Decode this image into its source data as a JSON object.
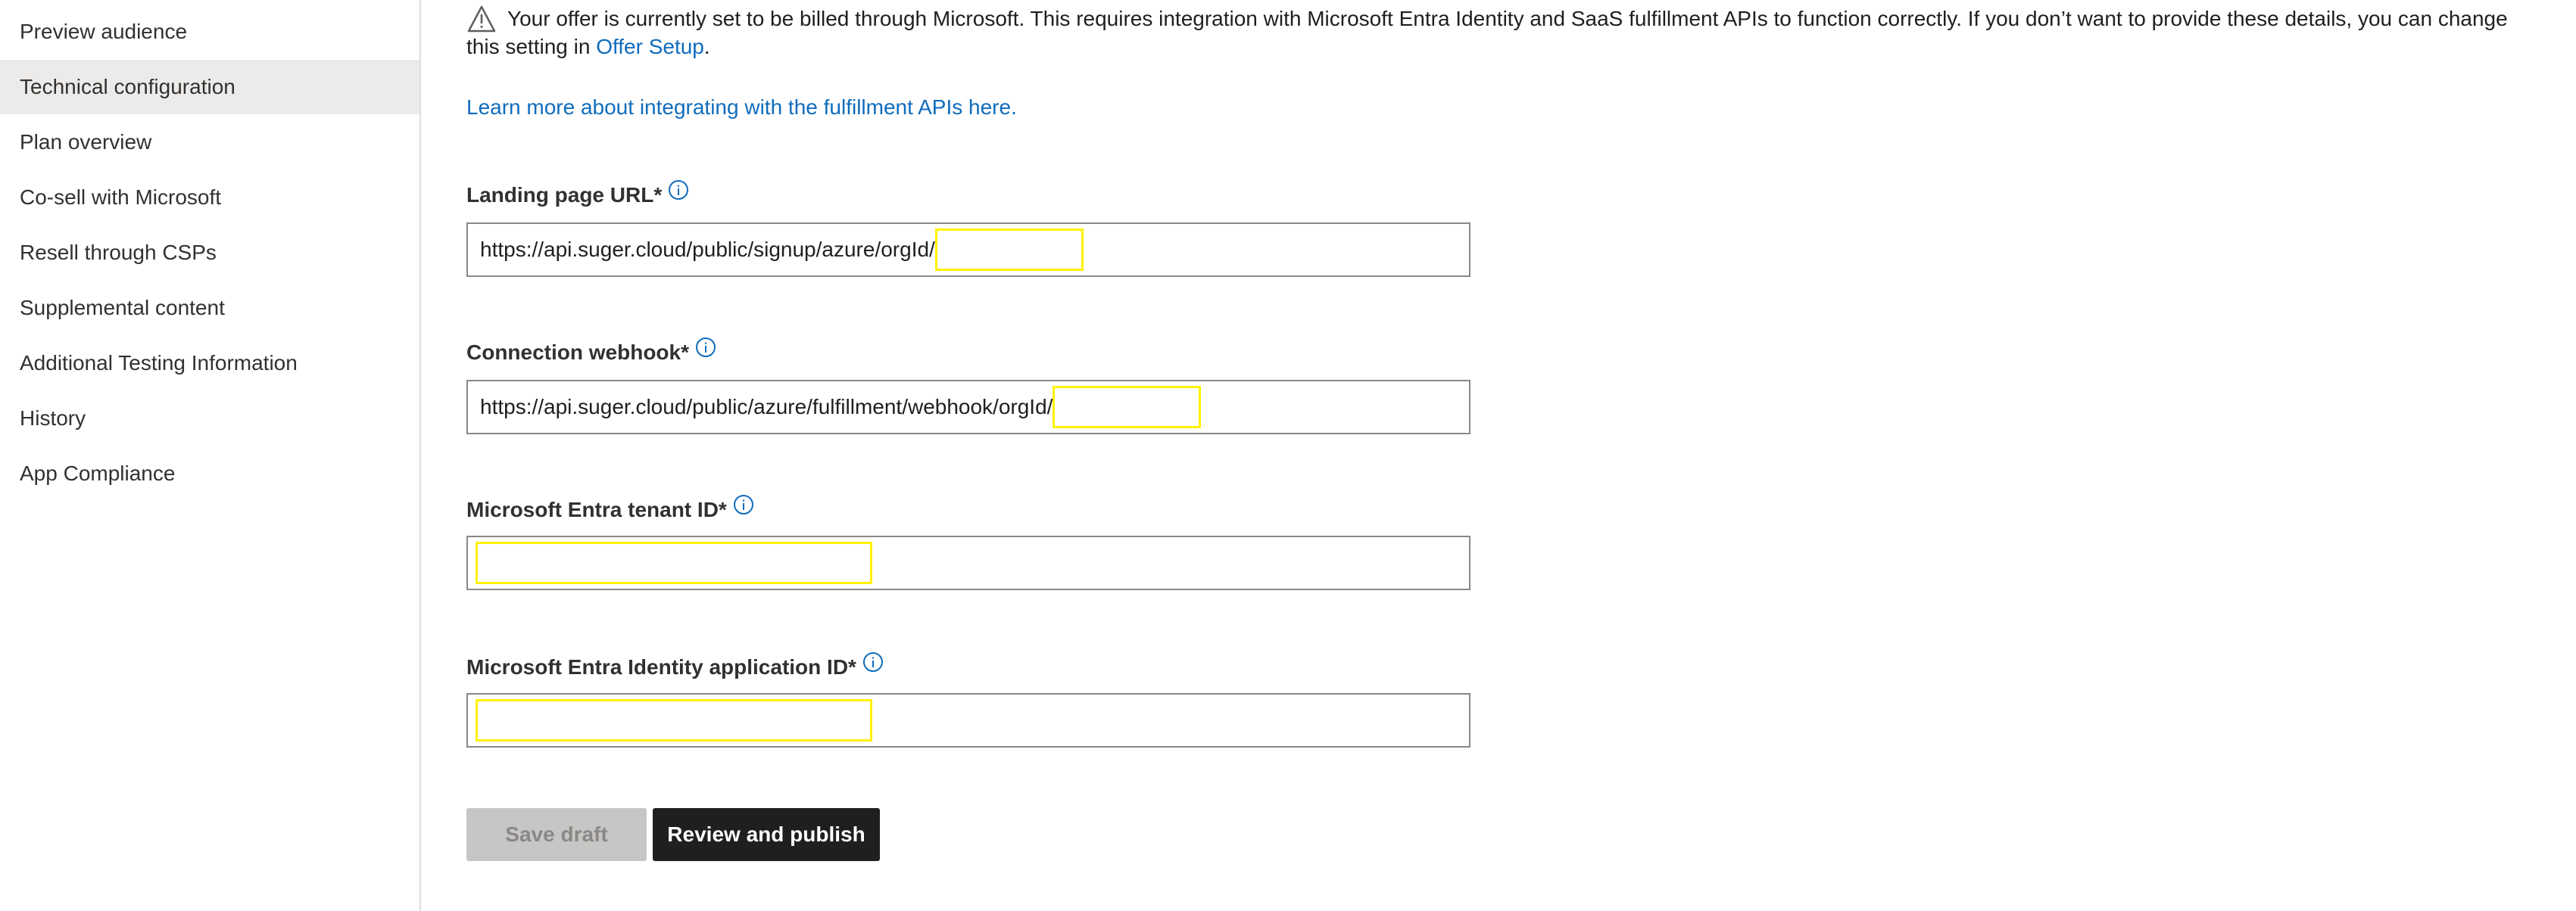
{
  "sidebar": {
    "items": [
      {
        "label": "Preview audience",
        "active": false
      },
      {
        "label": "Technical configuration",
        "active": true
      },
      {
        "label": "Plan overview",
        "active": false
      },
      {
        "label": "Co-sell with Microsoft",
        "active": false
      },
      {
        "label": "Resell through CSPs",
        "active": false
      },
      {
        "label": "Supplemental content",
        "active": false
      },
      {
        "label": "Additional Testing Information",
        "active": false
      },
      {
        "label": "History",
        "active": false
      },
      {
        "label": "App Compliance",
        "active": false
      }
    ]
  },
  "warning": {
    "icon": "warning-triangle-icon",
    "text_line1": "Your offer is currently set to be billed through Microsoft. This requires integration with Microsoft Entra Identity and SaaS fulfillment APIs to function correctly. If you don’t want to provide these details, you can change",
    "text_line2_prefix": "this setting in ",
    "link_label": "Offer Setup",
    "text_line2_suffix": "."
  },
  "learn_more_link": "Learn more about integrating with the fulfillment APIs here.",
  "fields": {
    "landing_page": {
      "label": "Landing page URL*",
      "value": "https://api.suger.cloud/public/signup/azure/orgId/"
    },
    "connection_webhook": {
      "label": "Connection webhook*",
      "value": "https://api.suger.cloud/public/azure/fulfillment/webhook/orgId/"
    },
    "tenant_id": {
      "label": "Microsoft Entra tenant ID*",
      "value": ""
    },
    "application_id": {
      "label": "Microsoft Entra Identity application ID*",
      "value": ""
    }
  },
  "buttons": {
    "save_draft": "Save draft",
    "review_publish": "Review and publish"
  },
  "colors": {
    "link": "#0f6cbd",
    "active_nav": "#edebe9",
    "redaction_outline": "#fff200",
    "primary_button": "#201f1e",
    "disabled_button": "#c8c6c4"
  }
}
